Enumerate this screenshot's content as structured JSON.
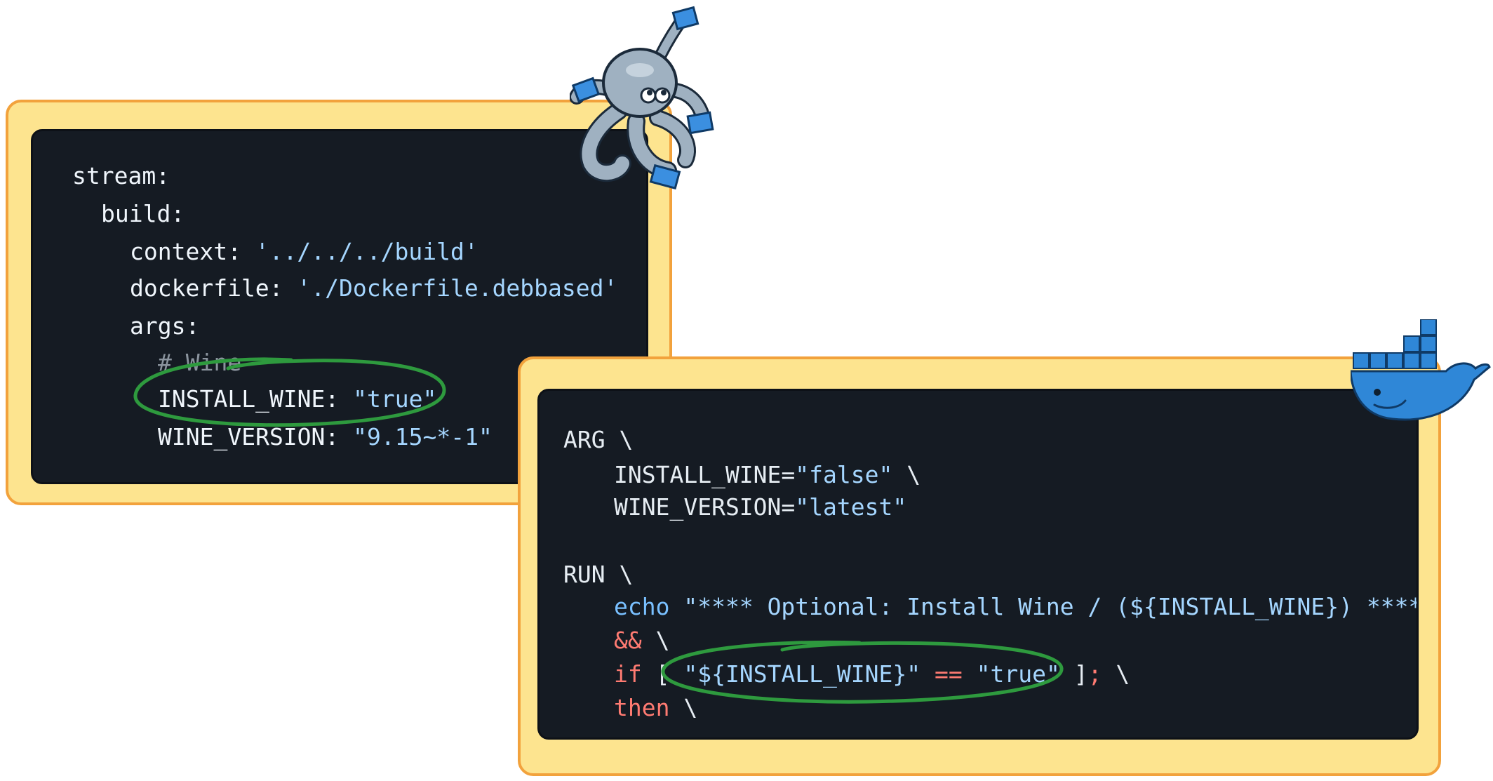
{
  "compose_snippet": {
    "lines": [
      {
        "key": "stream:"
      },
      {
        "key": "build:"
      },
      {
        "key": "context:",
        "value": "'../../../build'"
      },
      {
        "key": "dockerfile:",
        "value": "'./Dockerfile.debbased'"
      },
      {
        "key": "args:"
      },
      {
        "comment": "# Wine"
      },
      {
        "key": "INSTALL_WINE:",
        "value": "\"true\""
      },
      {
        "key": "WINE_VERSION:",
        "value": "\"9.15~*-1\""
      }
    ]
  },
  "dockerfile_snippet": {
    "arg_kw": "ARG",
    "cont": "\\",
    "install_wine_key": "INSTALL_WINE=",
    "install_wine_val": "\"false\"",
    "wine_version_key": "WINE_VERSION=",
    "wine_version_val": "\"latest\"",
    "run_kw": "RUN",
    "echo_kw": "echo",
    "echo_str": "\"**** Optional: Install Wine / (${INSTALL_WINE}) ****\"",
    "and_op": "&&",
    "if_kw": "if",
    "bracket_open": "[",
    "test_var": "\"${INSTALL_WINE}\"",
    "eq_op": "==",
    "test_val": "\"true\"",
    "bracket_close": "]",
    "semicolon": ";",
    "then_kw": "then"
  },
  "colors": {
    "frame_fill": "#fde48f",
    "frame_border": "#f2a23c",
    "code_bg": "#151b23",
    "highlight_circle": "#2e9a3e",
    "docker_blue": "#2f87d7"
  },
  "icons": {
    "compose_mascot": "docker-compose-octopus-icon",
    "docker_mascot": "docker-whale-icon"
  }
}
